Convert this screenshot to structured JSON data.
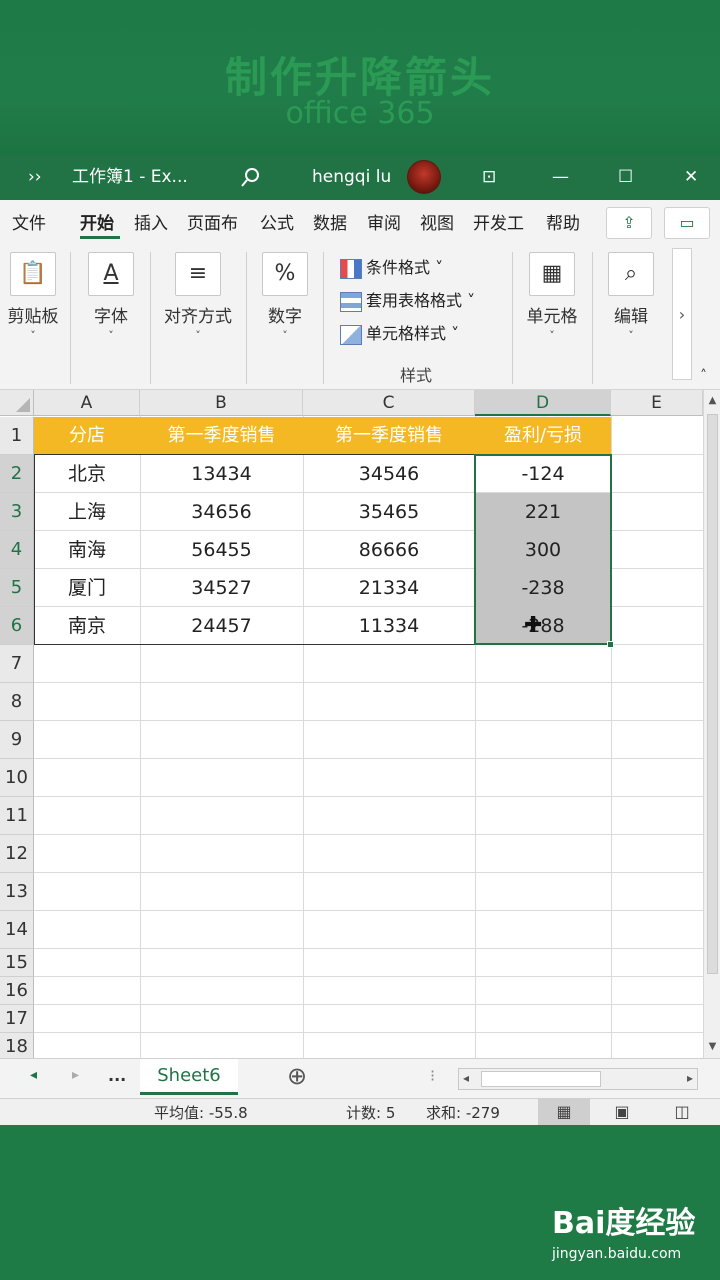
{
  "banner": {
    "title": "制作升降箭头",
    "subtitle": "office 365"
  },
  "titlebar": {
    "more": "››",
    "doc_title": "工作簿1  -  Ex...",
    "search_icon": "search-icon",
    "user": "hengqi lu",
    "ribbon_display": "⊡",
    "minimize": "—",
    "maximize": "☐",
    "close": "✕"
  },
  "tabs": [
    "文件",
    "开始",
    "插入",
    "页面布",
    "公式",
    "数据",
    "审阅",
    "视图",
    "开发工",
    "帮助"
  ],
  "ribbon": {
    "clipboard": "剪贴板",
    "font": "字体",
    "alignment": "对齐方式",
    "number": "数字",
    "conditional_format": "条件格式 ˅",
    "table_format": "套用表格格式 ˅",
    "cell_style": "单元格样式 ˅",
    "styles_group": "样式",
    "cells": "单元格",
    "editing": "编辑",
    "font_glyph": "A",
    "number_glyph": "%",
    "more_arrow": "›"
  },
  "sheet": {
    "columns": [
      "A",
      "B",
      "C",
      "D",
      "E"
    ],
    "rows": [
      "1",
      "2",
      "3",
      "4",
      "5",
      "6",
      "7",
      "8",
      "9",
      "10",
      "11",
      "12",
      "13",
      "14",
      "15",
      "16",
      "17",
      "18"
    ],
    "header": [
      "分店",
      "第一季度销售",
      "第一季度销售",
      "盈利/亏损"
    ],
    "data": [
      [
        "北京",
        "13434",
        "34546",
        "-124"
      ],
      [
        "上海",
        "34656",
        "35465",
        "221"
      ],
      [
        "南海",
        "56455",
        "86666",
        "300"
      ],
      [
        "厦门",
        "34527",
        "21334",
        "-238"
      ],
      [
        "南京",
        "24457",
        "11334",
        "-288"
      ]
    ],
    "cursor_glyph": "✚"
  },
  "sheetbar": {
    "prev": "◂",
    "next": "▸",
    "ellipsis": "...",
    "sheet_name": "Sheet6",
    "add": "⊕",
    "dots": "⁝"
  },
  "status": {
    "average": "平均值: -55.8",
    "count": "计数: 5",
    "sum": "求和: -279",
    "views": [
      "▦",
      "▣",
      "◫"
    ]
  },
  "watermark": {
    "brand": "Bai度经验",
    "url": "jingyan.baidu.com"
  },
  "colors": {
    "excel_green": "#217346",
    "header_fill": "#f4b824",
    "selection": "#c4c4c4"
  }
}
